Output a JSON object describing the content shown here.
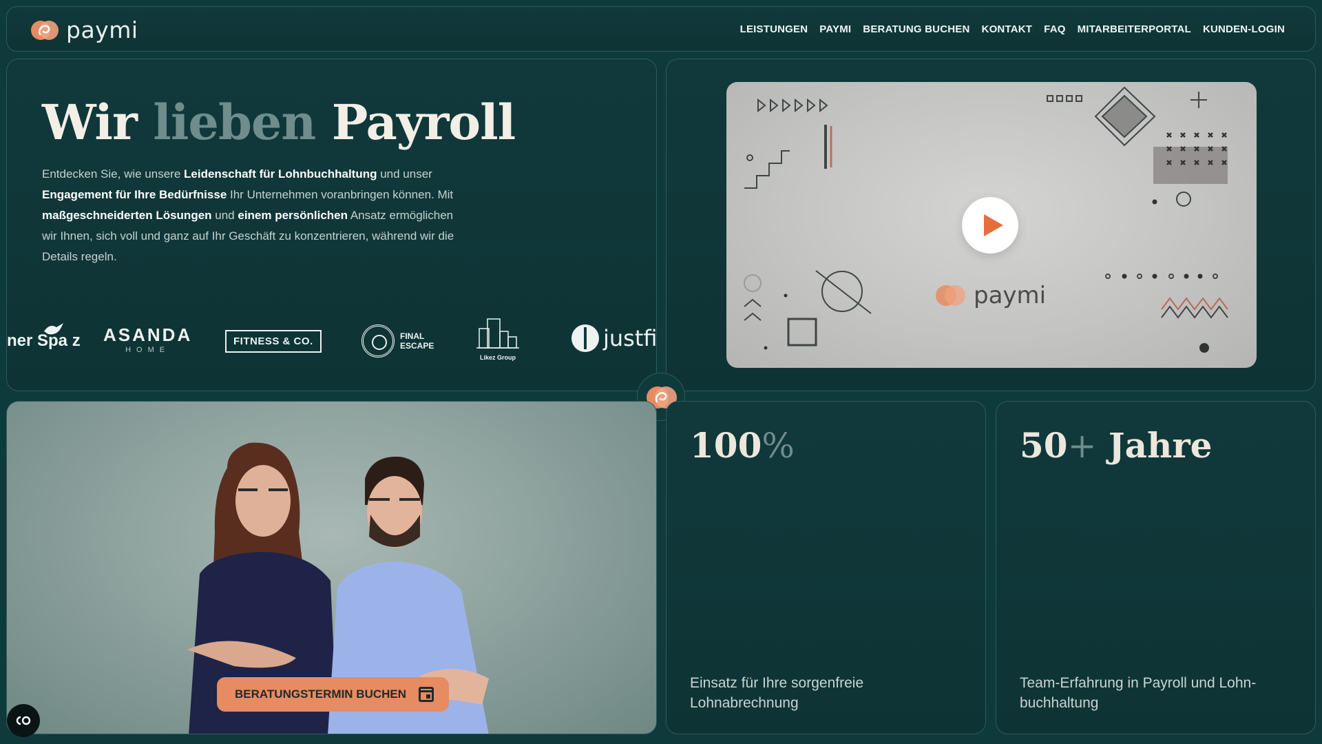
{
  "header": {
    "logo_text": "paymi",
    "nav": [
      "LEISTUNGEN",
      "PAYMI",
      "BERATUNG BUCHEN",
      "KONTAKT",
      "FAQ",
      "MITARBEITERPORTAL",
      "KUNDEN-LOGIN"
    ]
  },
  "hero": {
    "title_1": "Wir",
    "title_2": "lieben",
    "title_3": "Payroll",
    "p_1": "Entdecken Sie, wie unsere ",
    "p_b1": "Leidenschaft für Lohnbuchhaltung",
    "p_2": " und unser ",
    "p_b2": "Engagement für Ihre Bedürfnisse",
    "p_3": " Ihr Unternehmen voranbringen können. Mit ",
    "p_b3": "maßgeschneiderten Lösungen",
    "p_4": " und ",
    "p_b4": "einem persönlichen",
    "p_5": " Ansatz ermöglichen wir Ihnen, sich voll und ganz auf Ihr Geschäft zu konzentrieren, während wir die Details regeln."
  },
  "brands": {
    "spatz": "ner Spa  z",
    "asanda": "ASANDA",
    "asanda_sub": "HOME",
    "fitness": "FITNESS & CO.",
    "final_1": "FINAL",
    "final_2": "ESCAPE",
    "likez": "Likez Group",
    "justfit": "justfit"
  },
  "video": {
    "logo_text": "paymi"
  },
  "team": {
    "cta_label": "BERATUNGSTERMIN BUCHEN"
  },
  "stats": [
    {
      "num": "100",
      "suffix": "%",
      "desc": "Einsatz für Ihre sorgenfreie Lohnabrechnung"
    },
    {
      "num": "50",
      "suffix": "+",
      "unit": " Jahre",
      "desc": "Team-Erfahrung in Payroll und Lohn-buchhaltung"
    }
  ],
  "colors": {
    "background": "#0f3a3c",
    "accent": "#e78b63",
    "muted_text": "#6e8d8c"
  }
}
